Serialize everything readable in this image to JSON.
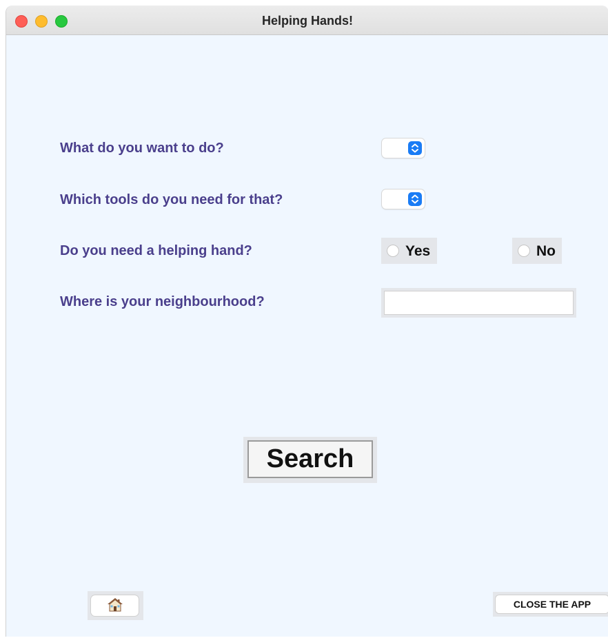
{
  "window": {
    "title": "Helping Hands!"
  },
  "form": {
    "activity_label": "What do you want to do?",
    "activity_value": "",
    "tools_label": "Which tools do you need for that?",
    "tools_value": "",
    "helping_hand_label": "Do you need a helping hand?",
    "helping_hand_options": [
      "Yes",
      "No"
    ],
    "neighbourhood_label": "Where is your neighbourhood?",
    "neighbourhood_value": ""
  },
  "actions": {
    "search_label": "Search",
    "home_icon": "house-icon",
    "close_label": "CLOSE THE APP"
  },
  "colors": {
    "background": "#f0f7ff",
    "label": "#4a3f8c",
    "select_accent": "#1a7cf5"
  }
}
